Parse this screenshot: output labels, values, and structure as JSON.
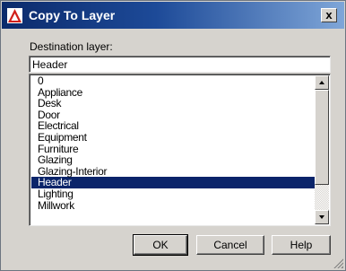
{
  "window": {
    "title": "Copy To Layer",
    "close_glyph": "x",
    "icon": "autocad-logo-icon"
  },
  "destination": {
    "label": "Destination layer:",
    "value": "Header"
  },
  "layers": {
    "items": [
      "0",
      "Appliance",
      "Desk",
      "Door",
      "Electrical",
      "Equipment",
      "Furniture",
      "Glazing",
      "Glazing-Interior",
      "Header",
      "Lighting",
      "Millwork"
    ],
    "selected": "Header",
    "selected_color": "#0a246a"
  },
  "buttons": {
    "ok": "OK",
    "cancel": "Cancel",
    "help": "Help"
  }
}
